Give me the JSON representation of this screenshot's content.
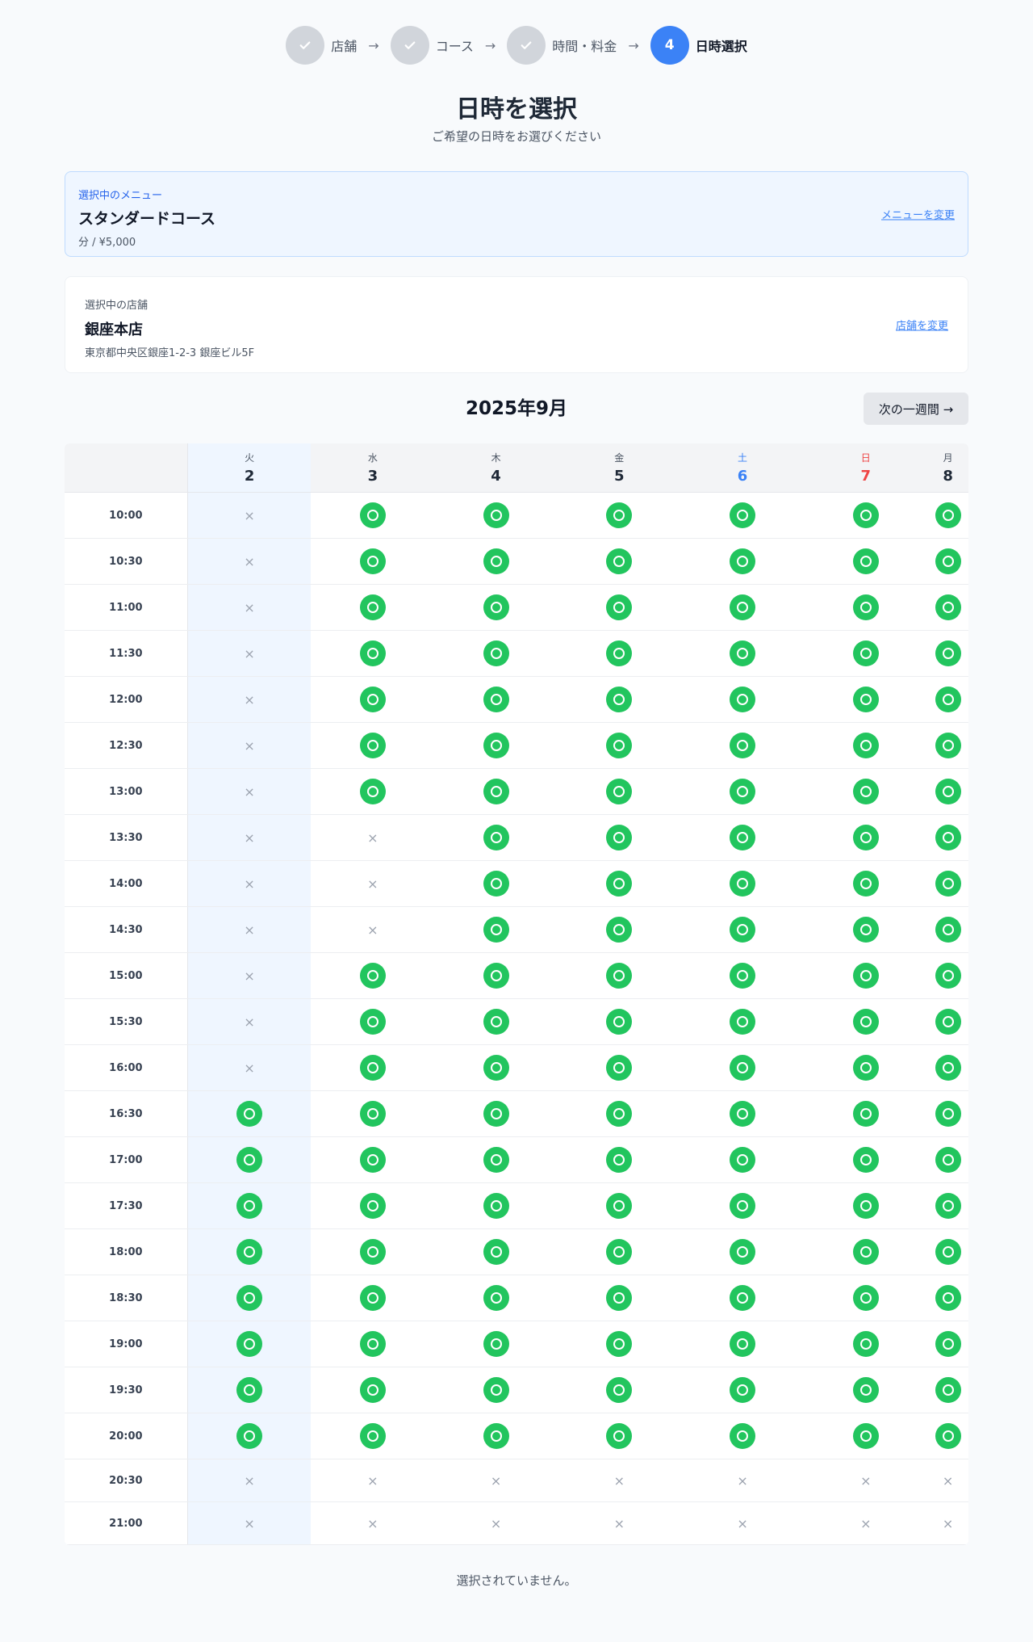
{
  "stepper": {
    "steps": [
      {
        "label": "店舗",
        "done": true
      },
      {
        "label": "コース",
        "done": true
      },
      {
        "label": "時間・料金",
        "done": true
      },
      {
        "label": "日時選択",
        "number": "4",
        "active": true
      }
    ],
    "check": "✓",
    "arrow": "→"
  },
  "page": {
    "title": "日時を選択",
    "subtitle": "ご希望の日時をお選びください"
  },
  "menu": {
    "caption": "選択中のメニュー",
    "name": "スタンダードコース",
    "meta": "分 / ¥5,000",
    "change": "メニューを変更"
  },
  "store": {
    "caption": "選択中の店舗",
    "name": "銀座本店",
    "address": "東京都中央区銀座1-2-3 銀座ビル5F",
    "change": "店舗を変更"
  },
  "calendar": {
    "month": "2025年9月",
    "next_week": "次の一週間 →",
    "days": [
      {
        "dow": "火",
        "num": "2",
        "kind": "weekday",
        "selected": true
      },
      {
        "dow": "水",
        "num": "3",
        "kind": "weekday"
      },
      {
        "dow": "木",
        "num": "4",
        "kind": "weekday"
      },
      {
        "dow": "金",
        "num": "5",
        "kind": "weekday"
      },
      {
        "dow": "土",
        "num": "6",
        "kind": "sat"
      },
      {
        "dow": "日",
        "num": "7",
        "kind": "sun"
      },
      {
        "dow": "月",
        "num": "8",
        "kind": "weekday"
      }
    ],
    "unavailable_mark": "×",
    "colors": {
      "available": "#22c55e",
      "selected_column": "#eff6ff",
      "saturday": "#3b82f6",
      "sunday": "#ef4444"
    },
    "slots": [
      {
        "time": "10:00",
        "avail": [
          0,
          1,
          1,
          1,
          1,
          1,
          1
        ]
      },
      {
        "time": "10:30",
        "avail": [
          0,
          1,
          1,
          1,
          1,
          1,
          1
        ]
      },
      {
        "time": "11:00",
        "avail": [
          0,
          1,
          1,
          1,
          1,
          1,
          1
        ]
      },
      {
        "time": "11:30",
        "avail": [
          0,
          1,
          1,
          1,
          1,
          1,
          1
        ]
      },
      {
        "time": "12:00",
        "avail": [
          0,
          1,
          1,
          1,
          1,
          1,
          1
        ]
      },
      {
        "time": "12:30",
        "avail": [
          0,
          1,
          1,
          1,
          1,
          1,
          1
        ]
      },
      {
        "time": "13:00",
        "avail": [
          0,
          1,
          1,
          1,
          1,
          1,
          1
        ]
      },
      {
        "time": "13:30",
        "avail": [
          0,
          0,
          1,
          1,
          1,
          1,
          1
        ]
      },
      {
        "time": "14:00",
        "avail": [
          0,
          0,
          1,
          1,
          1,
          1,
          1
        ]
      },
      {
        "time": "14:30",
        "avail": [
          0,
          0,
          1,
          1,
          1,
          1,
          1
        ]
      },
      {
        "time": "15:00",
        "avail": [
          0,
          1,
          1,
          1,
          1,
          1,
          1
        ]
      },
      {
        "time": "15:30",
        "avail": [
          0,
          1,
          1,
          1,
          1,
          1,
          1
        ]
      },
      {
        "time": "16:00",
        "avail": [
          0,
          1,
          1,
          1,
          1,
          1,
          1
        ]
      },
      {
        "time": "16:30",
        "avail": [
          1,
          1,
          1,
          1,
          1,
          1,
          1
        ]
      },
      {
        "time": "17:00",
        "avail": [
          1,
          1,
          1,
          1,
          1,
          1,
          1
        ]
      },
      {
        "time": "17:30",
        "avail": [
          1,
          1,
          1,
          1,
          1,
          1,
          1
        ]
      },
      {
        "time": "18:00",
        "avail": [
          1,
          1,
          1,
          1,
          1,
          1,
          1
        ]
      },
      {
        "time": "18:30",
        "avail": [
          1,
          1,
          1,
          1,
          1,
          1,
          1
        ]
      },
      {
        "time": "19:00",
        "avail": [
          1,
          1,
          1,
          1,
          1,
          1,
          1
        ]
      },
      {
        "time": "19:30",
        "avail": [
          1,
          1,
          1,
          1,
          1,
          1,
          1
        ]
      },
      {
        "time": "20:00",
        "avail": [
          1,
          1,
          1,
          1,
          1,
          1,
          1
        ]
      },
      {
        "time": "20:30",
        "avail": [
          0,
          0,
          0,
          0,
          0,
          0,
          0
        ]
      },
      {
        "time": "21:00",
        "avail": [
          0,
          0,
          0,
          0,
          0,
          0,
          0
        ]
      }
    ]
  },
  "status": "選択されていません。"
}
